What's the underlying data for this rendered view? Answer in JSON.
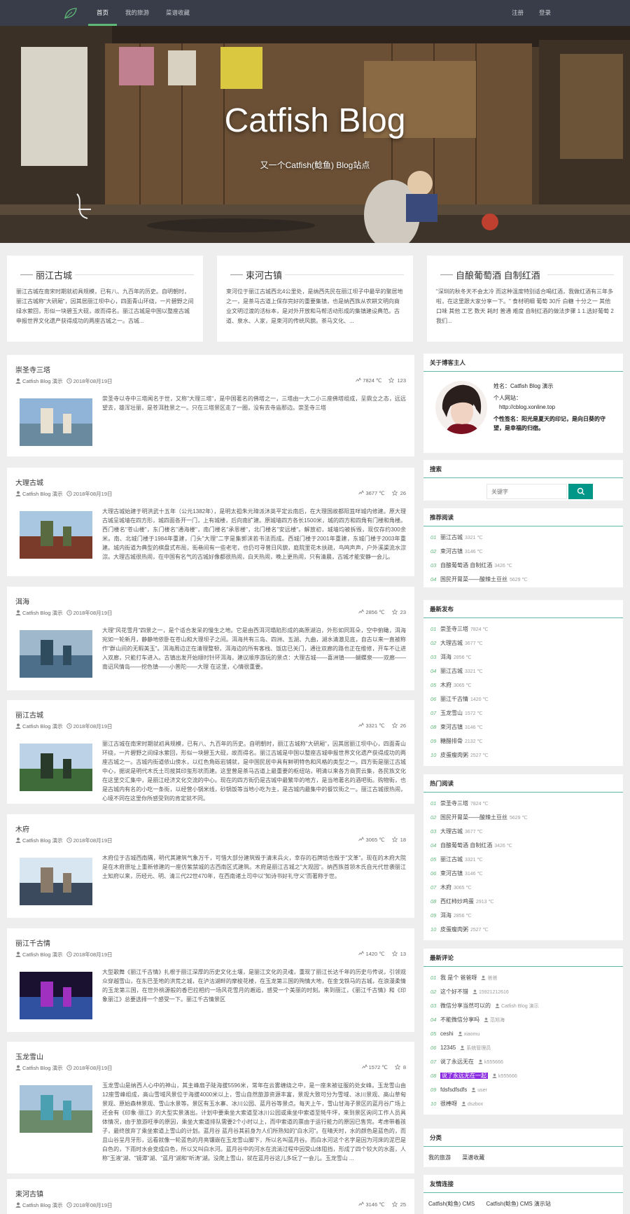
{
  "nav": {
    "items": [
      "首页",
      "我的旅游",
      "菜谱收藏"
    ],
    "active": 0,
    "right": [
      "注册",
      "登录"
    ],
    "logo_icon": "leaf-icon"
  },
  "hero": {
    "title": "Catfish Blog",
    "subtitle": "又一个Catfish(鲶鱼) Blog站点"
  },
  "features": [
    {
      "title": "丽江古城",
      "text": "丽江古城在南宋时期就初具规模，已有八、九百年的历史。自明朝时，丽江古城称\"大研厢\"，因其居丽江坝中心，四面青山环绕，一片碧野之间绿水萦回，形似一块碧玉大砚，故而得名。丽江古城是中国以整座古城申报世界文化遗产获得成功的两座古城之一。古城..."
    },
    {
      "title": "束河古镇",
      "text": "束河位于丽江古城西北4公里处，是纳西先民在丽江坝子中最早的聚居地之一，是茶马古道上保存完好的重要集镇，也是纳西族从农耕文明向商业文明过渡的活标本，是对外开放和马帮活动形成的集镇建设典范。古道、泉水、人家，是束河的传统风貌。茶马文化、..."
    },
    {
      "title": "自酿葡萄酒 自制红酒",
      "text": "\"深圳的秋冬天不会太冷 而这种温度特别适合喝红酒，我做红酒有三年多啦，在这里跟大家分享一下。\" 食材明细 葡萄 30斤 白糖 十分之一 其他 口味 其他 工艺 数天 耗时 普通 难度 自制红酒的做法步骤 1 1.选好葡萄 2 我们..."
    }
  ],
  "posts": [
    {
      "title": "崇圣寺三塔",
      "author": "Catfish Blog 演示",
      "date": "2018年08月19日",
      "views": "7824 ℃",
      "likes": "123",
      "excerpt": "崇圣寺以寺中三塔闻名于世，又称\"大理三塔\"，是中国著名的佛塔之一，三塔由一大二小三座佛塔组成，呈鼎立之态，远远望去，雄浑壮丽，是苍洱胜景之一。只在三塔景区走了一圈，没有去寺庙那边。崇圣寺三塔"
    },
    {
      "title": "大理古城",
      "author": "Catfish Blog 演示",
      "date": "2018年08月19日",
      "views": "3677 ℃",
      "likes": "26",
      "excerpt": "大理古城始建于明洪武十五年（公元1382年），是明太祖朱元璋派沐英平定云南后，在大理国故都阳苴咩城内修建。原大理古城呈城墙在四方形，城四面各开一门，上有城楼，后向南扩建。原城墙四方各长1500米，城的四方和四角有门楼和角楼。西门楼名\"苍山楼\"，东门楼名\"通海楼\"，南门楼名\"承恩楼\"，北门楼名\"安远楼\"。解放初，城墙均被拆毁，现仅存约300余米。南、北城门楼于1984年重建，门头\"大理\"二字是集郭沫若书法而成。西城门楼于2001年重建，东城门楼于2003年重建。城内街道为典型的棋盘式布局，街巷间有一些老宅，也仍可寻曾日风貌，庭院里花木扶疏，鸟鸣声声，户外溪渠流水淙淙。大理古城很热闹，在中国有名气的古城好像都很热闹，白天热闹，晚上更热闹，只有清晨，古城才能安静一会儿。"
    },
    {
      "title": "洱海",
      "author": "Catfish Blog 演示",
      "date": "2018年08月19日",
      "views": "2856 ℃",
      "likes": "23",
      "excerpt": "大理\"风花雪月\"四景之一，是个适合发呆的慢生之地。它是由西洱河塌陷形成的高原湖泊，外形如同耳朵，空中俯瞰，洱海宛如一轮新月，静静地依卧在苍山和大理坝子之间。洱海共有三岛、四洲、五湖、九曲，湖水清澈见底，自古以来一直被称作\"群山间的无暇美玉\"。洱海周边正在清理整顿，洱海边的所有客栈、饭店已关门，通往双廊的路也正在维修，开车不让进入双廊，只能打车进入。古镇出发开始顺时针环洱海，建议顺序游玩的景点：大理古城——喜洲镇——蝴蝶泉——双廊——南诏风情岛——挖色镇——小普陀——大理 在这里，心情很重要。"
    },
    {
      "title": "丽江古城",
      "author": "Catfish Blog 演示",
      "date": "2018年08月19日",
      "views": "3321 ℃",
      "likes": "26",
      "excerpt": "丽江古城在南宋时期就初具规模，已有八、九百年的历史。自明朝时，丽江古城称\"大研厢\"，因其居丽江坝中心，四面青山环绕，一片碧野之间绿水萦回，形似一块碧玉大砚，故而得名。丽江古城是中国以整座古城申报世界文化遗产获得成功的两座古城之一。古城内街道依山傍水，以红色角砾岩铺就，是中国民居中具有鲜明特色和风格的类型之一。四方街是丽江古城中心，据说是明代木氏土司按其印玺形状而建。这里曾是茶马古道上最重要的枢纽站，明清以来各方商贾云集，各民族文化在这里交汇集中，是丽江经济文化交流的中心。现在的四方街仍是古城中最繁华的地方，是当地著名的酒吧街。购物街，也是古城内有名的小吃一条街，以经营小锅米线，砂锅饭等当地小吃为主，是古城内最集中的餐饮街之一。丽江古城很热闹，心境不同在这里你所感受到的肯定就不同。"
    },
    {
      "title": "木府",
      "author": "Catfish Blog 演示",
      "date": "2018年08月19日",
      "views": "3065 ℃",
      "likes": "18",
      "excerpt": "木府位于古城西南隅，明代其建筑气象万千，可惜大部分建筑毁于清末兵火，幸存的石牌坊也毁于\"文革\"。现在的木府大院是在木府原址上重新修建的一座仿紫禁城的古西南区式建筑。木府是丽江古城之\"大观园\"。纳西族首领木氏自元代世袭丽江土知府以来，历经元、明、清三代22世470年，在西南诸土司中以\"知诗书好礼守义\"而著称于世。"
    },
    {
      "title": "丽江千古情",
      "author": "Catfish Blog 演示",
      "date": "2018年08月19日",
      "views": "1420 ℃",
      "likes": "13",
      "excerpt": "大型歌舞《丽江千古情》扎根于丽江深厚的历史文化土壤，是丽江文化的灵魂，重现了丽江长达千年的历史与传说，引领观众穿越雪山，在东巴圣地的洪荒之城，在泸沽湖畔的摩梭花楼，在玉龙第三国的殉情大地，在金戈铁马的古城，在浪漫柔情的玉龙第三国，在世外桃源般的香巴拉相约一场风花雪月的邂逅，感受一个美丽的时刻。来到丽江，《丽江千古情》和《印象丽江》总要选择一个感受一下。丽江千古情景区"
    },
    {
      "title": "玉龙雪山",
      "author": "Catfish Blog 演示",
      "date": "2018年08月19日",
      "views": "1572 ℃",
      "likes": "8",
      "excerpt": "玉龙雪山是纳西人心中的神山，其主峰扇子陡海拔5596米，常年在云雾缠绕之中，是一座未被征服的处女峰。玉龙雪山由12座雪峰组成，高山雪域风景位于海拔4000米以上，雪山自然旅游资源丰富，景观大致可分为雪域、冰川景观、高山草甸景观、原始森林景观、雪山水景等。景区有玉水寨、冰川公园、蓝月谷等景点。每天上午，雪山甘海子景区的蓝月谷广场上还会有《印象·丽江》的大型实景演出。计划中要乘坐大索道至冰川公园或乘坐中索道至牦牛坪，来到景区询问工作人员具体情况，由于旅游旺季的原因，乘坐大索道排队需要2个小时以上，而中索道的票由于运行能力的原因已售完。考虑带着孩子，最终放弃了乘坐索道上雪山的计划。蓝月谷 蓝月谷其前身为人们所熟知的\"白水河\"。在晴天时，水的颜色是蓝色的，而且山谷呈月牙形，远看就像一轮蓝色的月亮镶嵌在玉龙雪山脚下，所以名叫蓝月谷。而白水河这个名字是因为河床的泥巴是白色的，下雨时水会变成白色，所以又叫白水河。蓝月谷中的河水在流淌过程中因受山体阻挡，形成了四个较大的水面，人称\"玉液\"湖、\"镜潭\"湖、\"蓝月\"湖和\"听涛\"湖。没爬上雪山，就在蓝月谷这儿多玩了一会儿。玉龙雪山 ..."
    },
    {
      "title": "束河古镇",
      "author": "Catfish Blog 演示",
      "date": "2018年08月19日",
      "views": "3146 ℃",
      "likes": "25",
      "excerpt": ""
    }
  ],
  "about": {
    "heading": "关于博客主人",
    "name": "姓名：Catfish Blog 演示",
    "site_label": "个人网站：",
    "site": "http://cblog.xonline.top",
    "sign": "个性签名：阳光是夏天的印记，是向日葵的守望，是幸福的归宿。"
  },
  "search": {
    "heading": "搜索",
    "placeholder": "关键字",
    "button_icon": "search-icon"
  },
  "recommended": {
    "heading": "推荐阅读",
    "items": [
      {
        "n": "01",
        "t": "丽江古城",
        "v": "3321 ℃"
      },
      {
        "n": "02",
        "t": "束河古镇",
        "v": "3146 ℃"
      },
      {
        "n": "03",
        "t": "自酿葡萄酒 自制红酒",
        "v": "3426 ℃"
      },
      {
        "n": "04",
        "t": "国民开胃菜——酸辣土豆丝",
        "v": "5629 ℃"
      }
    ]
  },
  "latest": {
    "heading": "最新发布",
    "items": [
      {
        "n": "01",
        "t": "崇圣寺三塔",
        "v": "7824 ℃"
      },
      {
        "n": "02",
        "t": "大理古城",
        "v": "3677 ℃"
      },
      {
        "n": "03",
        "t": "洱海",
        "v": "2856 ℃"
      },
      {
        "n": "04",
        "t": "丽江古城",
        "v": "3321 ℃"
      },
      {
        "n": "05",
        "t": "木府",
        "v": "3065 ℃"
      },
      {
        "n": "06",
        "t": "丽江千古情",
        "v": "1420 ℃"
      },
      {
        "n": "07",
        "t": "玉龙雪山",
        "v": "1572 ℃"
      },
      {
        "n": "08",
        "t": "束河古镇",
        "v": "3146 ℃"
      },
      {
        "n": "09",
        "t": "糖醋排骨",
        "v": "2132 ℃"
      },
      {
        "n": "10",
        "t": "皮蛋瘦肉粥",
        "v": "2527 ℃"
      }
    ]
  },
  "hot": {
    "heading": "热门阅读",
    "items": [
      {
        "n": "01",
        "t": "崇圣寺三塔",
        "v": "7824 ℃"
      },
      {
        "n": "02",
        "t": "国民开胃菜——酸辣土豆丝",
        "v": "5629 ℃"
      },
      {
        "n": "03",
        "t": "大理古城",
        "v": "3677 ℃"
      },
      {
        "n": "04",
        "t": "自酿葡萄酒 自制红酒",
        "v": "3426 ℃"
      },
      {
        "n": "05",
        "t": "丽江古城",
        "v": "3321 ℃"
      },
      {
        "n": "06",
        "t": "束河古镇",
        "v": "3146 ℃"
      },
      {
        "n": "07",
        "t": "木府",
        "v": "3065 ℃"
      },
      {
        "n": "08",
        "t": "西红柿炒鸡蛋",
        "v": "2913 ℃"
      },
      {
        "n": "09",
        "t": "洱海",
        "v": "2856 ℃"
      },
      {
        "n": "10",
        "t": "皮蛋瘦肉粥",
        "v": "2527 ℃"
      }
    ]
  },
  "comments": {
    "heading": "最新评论",
    "items": [
      {
        "n": "01",
        "t": "我 是个 爸爸呀",
        "u": "爸爸"
      },
      {
        "n": "02",
        "t": "这个好不错",
        "u": "15921212616"
      },
      {
        "n": "03",
        "t": "微信分享当然可以的",
        "u": "Catfish Blog 演示"
      },
      {
        "n": "04",
        "t": "不能微信分享吗",
        "u": "范旭海"
      },
      {
        "n": "05",
        "t": "ceshi",
        "u": "xiaomu"
      },
      {
        "n": "06",
        "t": "12345",
        "u": "系统管理员"
      },
      {
        "n": "07",
        "t": "说了永远无在",
        "u": "k555666"
      },
      {
        "n": "08",
        "t": "说了永远无在一起",
        "u": "k555666"
      },
      {
        "n": "09",
        "t": "fdsfsdfsdfs",
        "u": "user"
      },
      {
        "n": "10",
        "t": "很棒呀",
        "u": "dszbox"
      }
    ]
  },
  "categories": {
    "heading": "分类",
    "items": [
      "我的旅游",
      "菜谱收藏"
    ]
  },
  "friends": {
    "heading": "友情连接",
    "items": [
      "Catfish(鲶鱼) CMS",
      "Catfish(鲶鱼) CMS 演示站"
    ]
  },
  "colors": {
    "nav_bg": "#393d49",
    "accent": "#5fb878",
    "button": "#009688"
  }
}
